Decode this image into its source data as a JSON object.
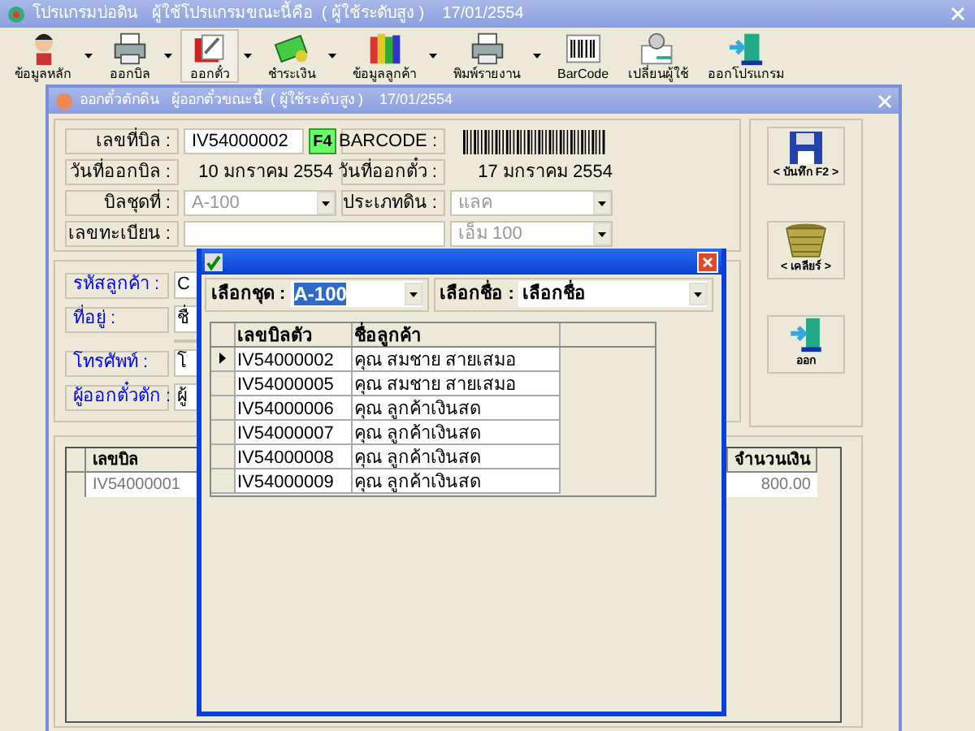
{
  "app": {
    "title": "โปรแกรมบ่อดิน   ผู้ใช้โปรแกรมขณะนี้คือ  ( ผู้ใช้ระดับสูง )    17/01/2554"
  },
  "toolbar": [
    {
      "label": "ข้อมูลหลัก",
      "kind": "person",
      "dropdown": true,
      "pressed": false
    },
    {
      "label": "ออกบิล",
      "kind": "printer",
      "dropdown": true,
      "pressed": false
    },
    {
      "label": "ออกตั๋ว",
      "kind": "ticket",
      "dropdown": true,
      "pressed": true
    },
    {
      "label": "ชำระเงิน",
      "kind": "money",
      "dropdown": true,
      "pressed": false
    },
    {
      "label": "ข้อมูลลูกค้า",
      "kind": "books",
      "dropdown": true,
      "pressed": false
    },
    {
      "label": "พิมพ์รายงาน",
      "kind": "printer",
      "dropdown": true,
      "pressed": false
    },
    {
      "label": "BarCode",
      "kind": "barcode",
      "dropdown": false,
      "pressed": false
    },
    {
      "label": "เปลี่ยนผู้ใช้",
      "kind": "user",
      "dropdown": false,
      "pressed": false
    },
    {
      "label": "ออกโปรแกรม",
      "kind": "door",
      "dropdown": false,
      "pressed": false
    }
  ],
  "window": {
    "title": "ออกตั๋วตักดิน   ผู้ออกตั๋วขณะนี้  ( ผู้ใช้ระดับสูง )    17/01/2554"
  },
  "form": {
    "bill_no_label": "เลขที่บิล :",
    "bill_no": "IV54000002",
    "lookup_key": "F4",
    "barcode_label": "BARCODE :",
    "bill_date_label": "วันที่ออกบิล :",
    "bill_date": "10 มกราคม 2554",
    "ticket_date_label": "วันที่ออกตั๋ว :",
    "ticket_date": "17 มกราคม 2554",
    "bill_set_label": "บิลชุดที่ :",
    "bill_set": "A-100",
    "soil_type_label": "ประเภทดิน :",
    "soil_type": "แลค",
    "registration_label": "เลขทะเบียน :",
    "unit": "เอ็ม 100"
  },
  "customer": {
    "fields": [
      {
        "label": "รหัสลูกค้า :",
        "value": "C"
      },
      {
        "label": "ที่อยู่ :",
        "value": "ชื่"
      },
      {
        "label": "โทรศัพท์ :",
        "value": "โ"
      },
      {
        "label": "ผู้ออกตั๋วตัก :",
        "value": "ผู้"
      }
    ]
  },
  "actions": [
    {
      "label": "< บันทึก F2 >",
      "kind": "save"
    },
    {
      "label": "< เคลียร์ >",
      "kind": "clear"
    },
    {
      "label": "ออก",
      "kind": "exit"
    }
  ],
  "bills_table": {
    "columns": [
      "เลขบิล",
      "จำนวนเงิน"
    ],
    "rows": [
      [
        "IV54000001",
        "800.00"
      ]
    ]
  },
  "popup": {
    "set_label": "เลือกชุด :",
    "set_value": "A-100",
    "name_label": "เลือกชื่อ :",
    "name_value": "เลือกชื่อ",
    "columns": [
      "เลขบิลตัว",
      "ชื่อลูกค้า"
    ],
    "rows": [
      {
        "bill": "IV54000002",
        "name": "คุณ สมชาย สายเสมอ",
        "selected": true
      },
      {
        "bill": "IV54000005",
        "name": "คุณ สมชาย สายเสมอ",
        "selected": false
      },
      {
        "bill": "IV54000006",
        "name": "คุณ ลูกค้าเงินสด",
        "selected": false
      },
      {
        "bill": "IV54000007",
        "name": "คุณ ลูกค้าเงินสด",
        "selected": false
      },
      {
        "bill": "IV54000008",
        "name": "คุณ ลูกค้าเงินสด",
        "selected": false
      },
      {
        "bill": "IV54000009",
        "name": "คุณ ลูกค้าเงินสด",
        "selected": false
      }
    ]
  }
}
